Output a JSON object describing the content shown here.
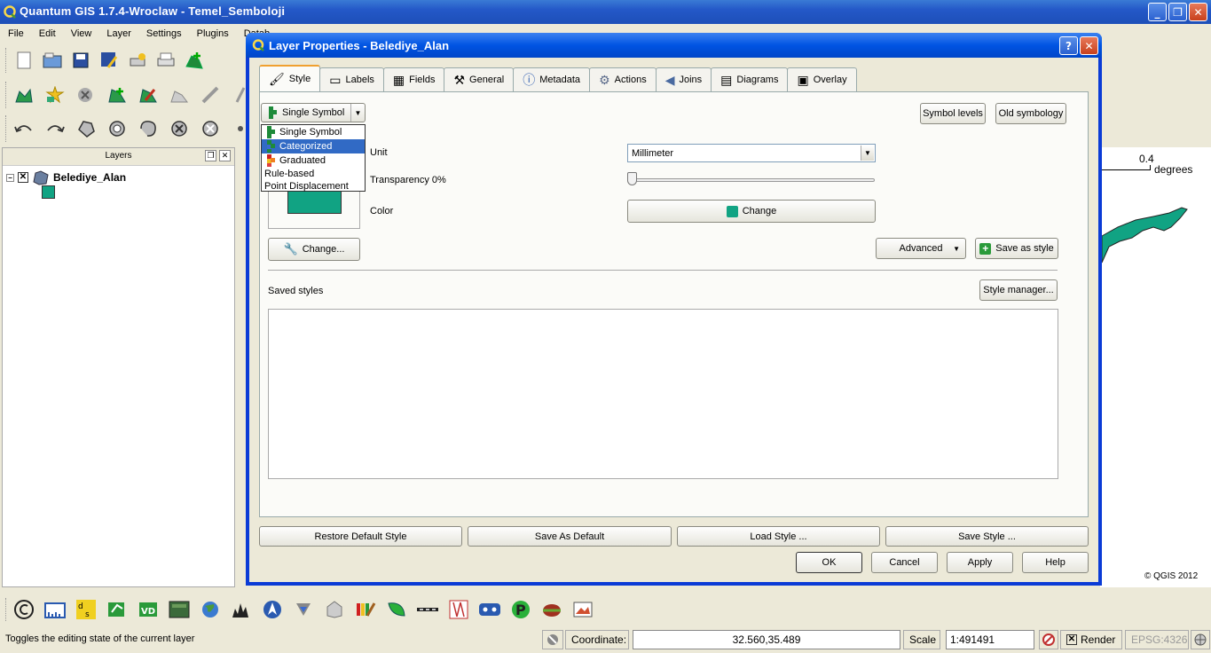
{
  "main_window": {
    "title": "Quantum GIS 1.7.4-Wroclaw - Temel_Semboloji",
    "controls": [
      "_",
      "❐",
      "✕"
    ]
  },
  "menubar": [
    "File",
    "Edit",
    "View",
    "Layer",
    "Settings",
    "Plugins",
    "Datab"
  ],
  "toolbar_icons": {
    "row1": [
      "new-project-icon",
      "open-project-icon",
      "save-project-icon",
      "save-as-icon",
      "print-composer-icon",
      "print-icon",
      "add-feature-icon"
    ],
    "row2": [
      "add-vector-layer-icon",
      "add-raster-layer-icon",
      "remove-layer-icon",
      "digitize-icon",
      "edit-icon",
      "capture-polygon-icon",
      "measure-icon",
      "pan-icon"
    ],
    "row3": [
      "undo-icon",
      "redo-icon",
      "simplify-feature-icon",
      "add-ring-icon",
      "add-part-icon",
      "delete-ring-icon",
      "delete-part-icon",
      "node-tool-icon"
    ]
  },
  "layers_panel": {
    "title": "Layers",
    "layer_name": "Belediye_Alan",
    "layer_color": "#11a383"
  },
  "map": {
    "scale_value": "0.4",
    "scale_unit": "degrees",
    "copyright": "© QGIS 2012",
    "polygon_color": "#11a383"
  },
  "dialog": {
    "title": "Layer Properties - Belediye_Alan",
    "help": "?",
    "close": "✕",
    "tabs": [
      {
        "label": "Style",
        "icon": "style-icon"
      },
      {
        "label": "Labels",
        "icon": "labels-icon"
      },
      {
        "label": "Fields",
        "icon": "fields-icon"
      },
      {
        "label": "General",
        "icon": "general-icon"
      },
      {
        "label": "Metadata",
        "icon": "metadata-icon"
      },
      {
        "label": "Actions",
        "icon": "actions-icon"
      },
      {
        "label": "Joins",
        "icon": "joins-icon"
      },
      {
        "label": "Diagrams",
        "icon": "diagrams-icon"
      },
      {
        "label": "Overlay",
        "icon": "overlay-icon"
      }
    ],
    "renderer_combo": "Single Symbol",
    "renderer_options": [
      {
        "label": "Single Symbol",
        "selected": false
      },
      {
        "label": "Categorized",
        "selected": true
      },
      {
        "label": "Graduated",
        "selected": false
      },
      {
        "label": "Rule-based",
        "selected": false
      },
      {
        "label": "Point Displacement",
        "selected": false
      }
    ],
    "symbol_levels": "Symbol levels",
    "old_symbology": "Old symbology",
    "unit_label": "Unit",
    "unit_value": "Millimeter",
    "transparency_label": "Transparency 0%",
    "transparency_value": 0,
    "color_label": "Color",
    "color_button": "Change",
    "symbol_color": "#11a383",
    "change_symbol": "Change...",
    "advanced": "Advanced",
    "save_as_style": "Save as style",
    "saved_styles_label": "Saved styles",
    "style_manager": "Style manager...",
    "restore_default": "Restore Default Style",
    "save_as_default": "Save As Default",
    "load_style": "Load Style ...",
    "save_style": "Save Style ...",
    "ok": "OK",
    "cancel": "Cancel",
    "apply": "Apply",
    "help_button": "Help"
  },
  "bottom_toolbar_icons": [
    "copyright-label-icon",
    "scale-bar-icon",
    "d2s-icon",
    "georeferencer-icon",
    "interpolation-icon",
    "grass-icon",
    "globe-icon",
    "histogram-icon",
    "north-arrow-icon",
    "gps-icon",
    "3d-icon",
    "raster-terrain-icon",
    "leaf-icon",
    "road-graph-icon",
    "spatial-query-icon",
    "python-icon",
    "plugin-icon",
    "mapserver-icon",
    "image-export-icon"
  ],
  "statusbar": {
    "message": "Toggles the editing state of the current layer",
    "coordinate_label": "Coordinate:",
    "coordinate_value": "32.560,35.489",
    "scale_label": "Scale",
    "scale_value": "1:491491",
    "render_label": "Render",
    "crs": "EPSG:4326"
  }
}
